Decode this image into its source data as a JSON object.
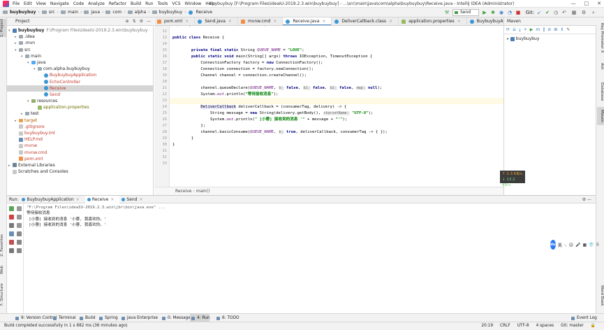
{
  "window": {
    "title": "buybuybuy [F:\\Program Files\\ideaIU-2019.2.3.win\\buybuybuy] - ...\\src\\main\\java\\com\\alpha\\buybuybuy\\Receive.java - IntelliJ IDEA (Administrator)",
    "menu": [
      "File",
      "Edit",
      "View",
      "Navigate",
      "Code",
      "Analyze",
      "Refactor",
      "Build",
      "Run",
      "Tools",
      "VCS",
      "Window",
      "Help"
    ],
    "controls": [
      "—",
      "□",
      "✕"
    ]
  },
  "navbar": {
    "crumbs": [
      "buybuybuy",
      "src",
      "main",
      "java",
      "com",
      "alpha",
      "buybuybuy",
      "Receive"
    ],
    "run_config": "Send",
    "git_label": "Git:"
  },
  "project": {
    "header": "Project",
    "tree": [
      {
        "label": "buybuybuy",
        "suffix": "F:\\Program Files\\ideaIU-2019.2.3.win\\buybuybuy",
        "depth": 0,
        "arrow": "▾",
        "icon": "mod",
        "bold": true
      },
      {
        "label": ".idea",
        "depth": 1,
        "arrow": "▸",
        "icon": "folder"
      },
      {
        "label": ".mvn",
        "depth": 1,
        "arrow": "▸",
        "icon": "folder"
      },
      {
        "label": "src",
        "depth": 1,
        "arrow": "▾",
        "icon": "folder"
      },
      {
        "label": "main",
        "depth": 2,
        "arrow": "▾",
        "icon": "folder"
      },
      {
        "label": "java",
        "depth": 3,
        "arrow": "▾",
        "icon": "src"
      },
      {
        "label": "com.alpha.buybuybuy",
        "depth": 4,
        "arrow": "▾",
        "icon": "folder"
      },
      {
        "label": "BuybuybuyApplication",
        "depth": 5,
        "arrow": "",
        "icon": "class",
        "color": "red"
      },
      {
        "label": "EchoController",
        "depth": 5,
        "arrow": "",
        "icon": "class",
        "color": "red"
      },
      {
        "label": "Receive",
        "depth": 5,
        "arrow": "",
        "icon": "class",
        "color": "red",
        "selected": true
      },
      {
        "label": "Send",
        "depth": 5,
        "arrow": "",
        "icon": "class",
        "color": "red"
      },
      {
        "label": "resources",
        "depth": 3,
        "arrow": "▾",
        "icon": "res"
      },
      {
        "label": "application.properties",
        "depth": 4,
        "arrow": "",
        "icon": "props",
        "color": "olive"
      },
      {
        "label": "test",
        "depth": 2,
        "arrow": "▸",
        "icon": "folder"
      },
      {
        "label": "target",
        "depth": 1,
        "arrow": "▸",
        "icon": "tgt",
        "color": "orange"
      },
      {
        "label": ".gitignore",
        "depth": 1,
        "arrow": "",
        "icon": "file",
        "color": "red"
      },
      {
        "label": "buybuybuy.iml",
        "depth": 1,
        "arrow": "",
        "icon": "file",
        "color": "red"
      },
      {
        "label": "HELP.md",
        "depth": 1,
        "arrow": "",
        "icon": "md",
        "color": "red"
      },
      {
        "label": "mvnw",
        "depth": 1,
        "arrow": "",
        "icon": "file",
        "color": "red"
      },
      {
        "label": "mvnw.cmd",
        "depth": 1,
        "arrow": "",
        "icon": "file",
        "color": "red"
      },
      {
        "label": "pom.xml",
        "depth": 1,
        "arrow": "",
        "icon": "xml",
        "color": "red"
      },
      {
        "label": "External Libraries",
        "depth": 0,
        "arrow": "▸",
        "icon": "lib"
      },
      {
        "label": "Scratches and Consoles",
        "depth": 0,
        "arrow": "",
        "icon": "file"
      }
    ]
  },
  "editor_tabs": [
    {
      "label": "pom.xml",
      "kind": "xmlt"
    },
    {
      "label": "Send.java",
      "kind": ""
    },
    {
      "label": "mvnw.cmd",
      "kind": "xmlt"
    },
    {
      "label": "Receive.java",
      "kind": "",
      "active": true
    },
    {
      "label": "DeliverCallback.class",
      "kind": ""
    },
    {
      "label": "application.properties",
      "kind": "pt"
    },
    {
      "label": "BuybuybuyApplication.java",
      "kind": ""
    },
    {
      "label": "EchoContro",
      "kind": ""
    }
  ],
  "code": {
    "line_numbers": [
      "",
      "12",
      "13",
      "14",
      "15",
      "16",
      "17",
      "18",
      "19",
      "20",
      "21",
      "22",
      "23",
      "24",
      "25",
      "26",
      "27",
      "28",
      "29",
      "30",
      "31",
      "32",
      "33"
    ],
    "current_line_index": 12
  },
  "editor_breadcrumb": [
    "Receive",
    "main()"
  ],
  "maven": {
    "header": "Maven",
    "project": "buybuybuy"
  },
  "memory": {
    "up": "↑ 2.3 KB/s",
    "down": "↓ 13.2 KB/s"
  },
  "run": {
    "label": "Run:",
    "tabs": [
      {
        "label": "BuybuybuyApplication"
      },
      {
        "label": "Receive",
        "active": true
      },
      {
        "label": "Send"
      }
    ],
    "console": [
      "\"F:\\Program Files\\ideaIU-2019.2.3.win\\jbr\\bin\\java.exe\" ...",
      "等待接收消息",
      " [小蓉] 接收到的消息 '小蓉, 我喜欢你。'",
      " [小蓉] 接收到的消息 '小蓉, 我喜欢你。'"
    ]
  },
  "left_tabs": [
    "1: Project",
    "2: Favorites",
    "Web",
    "7: Structure"
  ],
  "right_tabs": [
    "Key Promoter X",
    "Ant",
    "Database",
    "Maven",
    "Word Book"
  ],
  "bottom_tabs": [
    {
      "label": "9: Version Control"
    },
    {
      "label": "Terminal"
    },
    {
      "label": "Build"
    },
    {
      "label": "Spring"
    },
    {
      "label": "Java Enterprise"
    },
    {
      "label": "0: Messages"
    },
    {
      "label": "4: Run",
      "active": true
    },
    {
      "label": "6: TODO"
    },
    {
      "label": "Event Log"
    }
  ],
  "status": {
    "message": "Build completed successfully in 1 s 882 ms (36 minutes ago)",
    "position": "20:19",
    "line_sep": "CRLF",
    "encoding": "UTF-8",
    "indent": "4 spaces",
    "git": "Git: master"
  },
  "ime": {
    "logo": "du",
    "items": [
      "英",
      "·,",
      "☺",
      "🎤",
      "▦",
      "👕",
      "⠿"
    ]
  },
  "colors": {
    "accent": "#4a88c7",
    "selection": "#d5d5d5",
    "current_line": "#fffae3",
    "keyword": "#000080",
    "string": "#008000",
    "field": "#660e7a"
  }
}
